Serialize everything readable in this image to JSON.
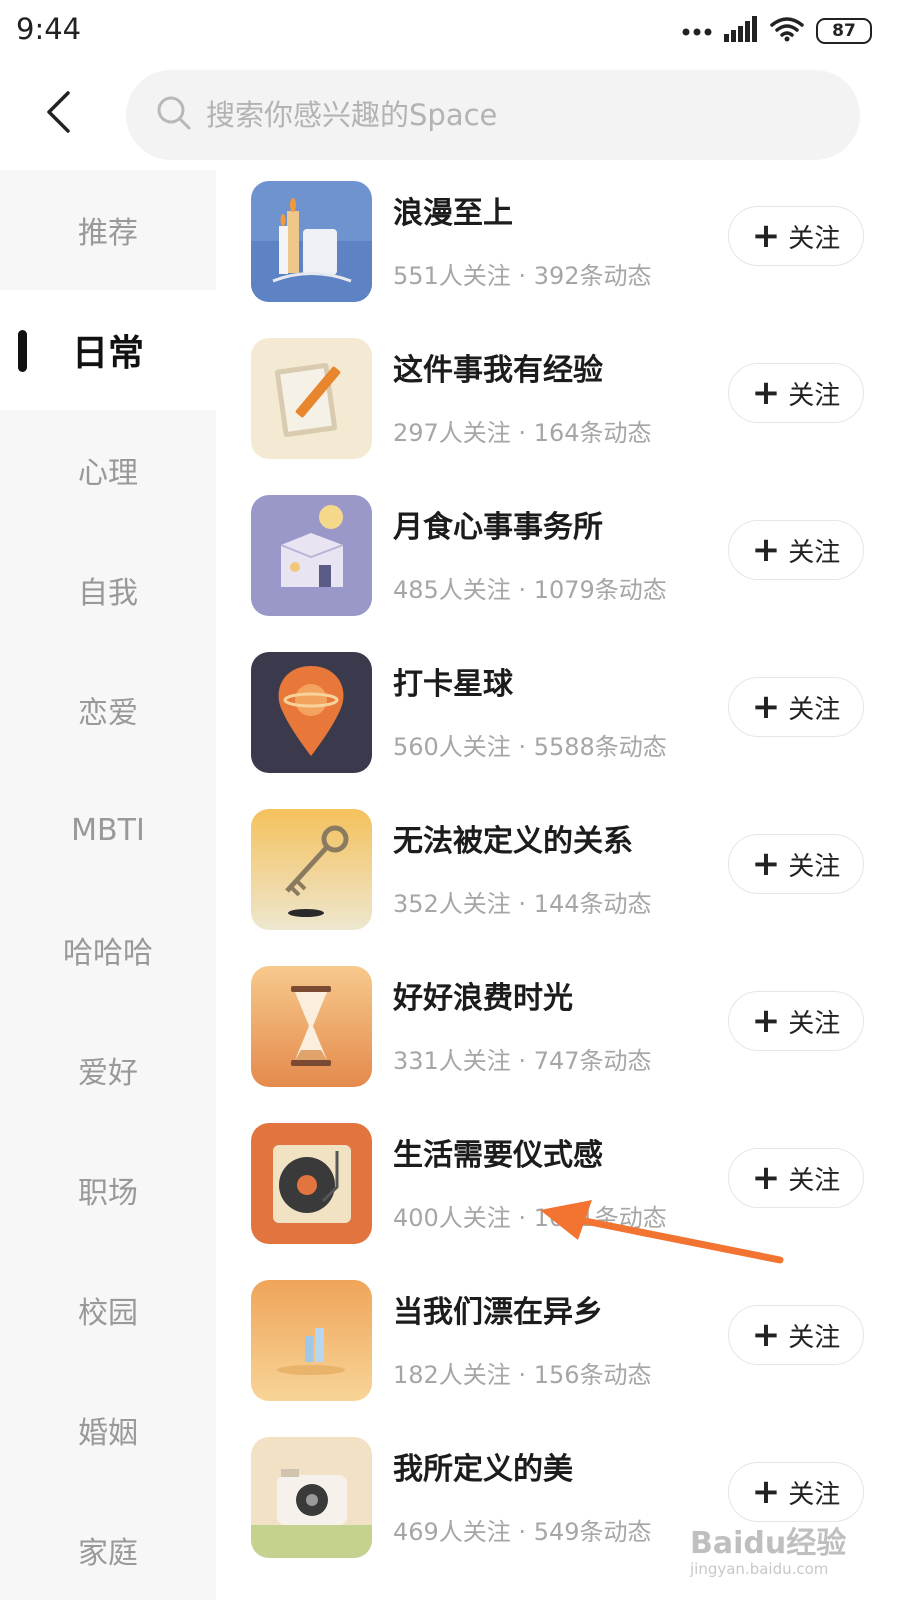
{
  "status_bar": {
    "time": "9:44",
    "battery": "87"
  },
  "search": {
    "placeholder": "搜索你感兴趣的Space"
  },
  "sidebar": {
    "items": [
      {
        "label": "推荐"
      },
      {
        "label": "日常"
      },
      {
        "label": "心理"
      },
      {
        "label": "自我"
      },
      {
        "label": "恋爱"
      },
      {
        "label": "MBTI"
      },
      {
        "label": "哈哈哈"
      },
      {
        "label": "爱好"
      },
      {
        "label": "职场"
      },
      {
        "label": "校园"
      },
      {
        "label": "婚姻"
      },
      {
        "label": "家庭"
      }
    ],
    "active": "日常"
  },
  "follow_label": "关注",
  "spaces": [
    {
      "title": "浪漫至上",
      "meta": "551人关注 · 392条动态",
      "icon": "candles-icon"
    },
    {
      "title": "这件事我有经验",
      "meta": "297人关注 · 164条动态",
      "icon": "notebook-pencil-icon"
    },
    {
      "title": "月食心事事务所",
      "meta": "485人关注 · 1079条动态",
      "icon": "moon-box-icon"
    },
    {
      "title": "打卡星球",
      "meta": "560人关注 · 5588条动态",
      "icon": "planet-pin-icon"
    },
    {
      "title": "无法被定义的关系",
      "meta": "352人关注 · 144条动态",
      "icon": "key-icon"
    },
    {
      "title": "好好浪费时光",
      "meta": "331人关注 · 747条动态",
      "icon": "hourglass-icon"
    },
    {
      "title": "生活需要仪式感",
      "meta": "400人关注 · 1051条动态",
      "icon": "record-player-icon"
    },
    {
      "title": "当我们漂在异乡",
      "meta": "182人关注 · 156条动态",
      "icon": "moon-city-icon"
    },
    {
      "title": "我所定义的美",
      "meta": "469人关注 · 549条动态",
      "icon": "camera-icon"
    }
  ],
  "watermark": {
    "text": "Baidu经验",
    "sub": "jingyan.baidu.com"
  },
  "colors": {
    "accent_arrow": "#f27430",
    "meta_gray": "#a6a6a6",
    "sidebar_bg": "#f7f7f7"
  }
}
